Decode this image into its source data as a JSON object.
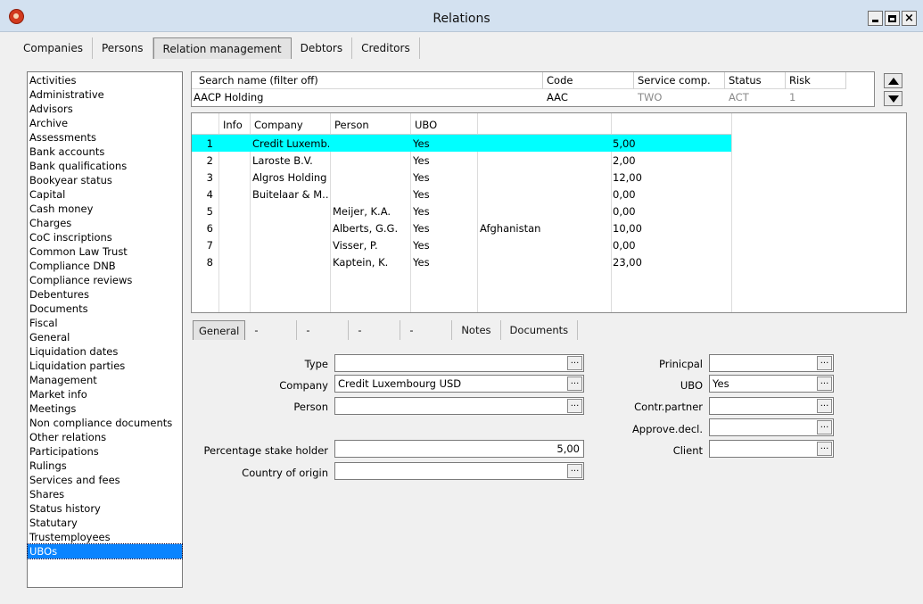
{
  "window": {
    "title": "Relations"
  },
  "top_tabs": [
    "Companies",
    "Persons",
    "Relation management",
    "Debtors",
    "Creditors"
  ],
  "top_tab_active": 2,
  "sidebar": {
    "items": [
      "Activities",
      "Administrative",
      "Advisors",
      "Archive",
      "Assessments",
      "Bank accounts",
      "Bank qualifications",
      "Bookyear status",
      "Capital",
      "Cash money",
      "Charges",
      "CoC inscriptions",
      "Common Law Trust",
      "Compliance DNB",
      "Compliance reviews",
      "Debentures",
      "Documents",
      "Fiscal",
      "General",
      "Liquidation dates",
      "Liquidation parties",
      "Management",
      "Market info",
      "Meetings",
      "Non compliance documents",
      "Other relations",
      "Participations",
      "Rulings",
      "Services and fees",
      "Shares",
      "Status history",
      "Statutary",
      "Trustemployees",
      "UBOs"
    ],
    "selected": "UBOs"
  },
  "filter": {
    "headers": [
      "Search name (filter off)",
      "Code",
      "Service comp.",
      "Status",
      "Risk"
    ],
    "row": [
      "AACP Holding",
      "AAC",
      "TWO",
      "ACT",
      "1"
    ]
  },
  "grid": {
    "headers": [
      "",
      "Info",
      "Company",
      "Person",
      "UBO",
      "",
      ""
    ],
    "rows": [
      [
        "1",
        "",
        "Credit Luxemb...",
        "",
        "Yes",
        "",
        "5,00"
      ],
      [
        "2",
        "",
        "Laroste B.V.",
        "",
        "Yes",
        "",
        "2,00"
      ],
      [
        "3",
        "",
        "Algros Holding",
        "",
        "Yes",
        "",
        "12,00"
      ],
      [
        "4",
        "",
        "Buitelaar & M...",
        "",
        "Yes",
        "",
        "0,00"
      ],
      [
        "5",
        "",
        "",
        "Meijer, K.A.",
        "Yes",
        "",
        "0,00"
      ],
      [
        "6",
        "",
        "",
        "Alberts, G.G.",
        "Yes",
        "Afghanistan",
        "10,00"
      ],
      [
        "7",
        "",
        "",
        "Visser, P.",
        "Yes",
        "",
        "0,00"
      ],
      [
        "8",
        "",
        "",
        "Kaptein, K.",
        "Yes",
        "",
        "23,00"
      ]
    ],
    "selected_row": 0
  },
  "sub_tabs": [
    "General",
    "-",
    "-",
    "-",
    "-",
    "Notes",
    "Documents"
  ],
  "sub_tab_active": 0,
  "form_left": {
    "type_label": "Type",
    "type_value": "",
    "company_label": "Company",
    "company_value": "Credit Luxembourg USD",
    "person_label": "Person",
    "person_value": "",
    "stake_label": "Percentage stake holder",
    "stake_value": "5,00",
    "country_label": "Country of origin",
    "country_value": ""
  },
  "form_right": {
    "principal_label": "Prinicpal",
    "principal_value": "",
    "ubo_label": "UBO",
    "ubo_value": "Yes",
    "contr_label": "Contr.partner",
    "contr_value": "",
    "approve_label": "Approve.decl.",
    "approve_value": "",
    "client_label": "Client",
    "client_value": ""
  },
  "lookup_button_label": "...",
  "colors": {
    "selection_row": "#00ffff",
    "list_selection": "#0a84ff",
    "titlebar": "#d3e1f0"
  }
}
